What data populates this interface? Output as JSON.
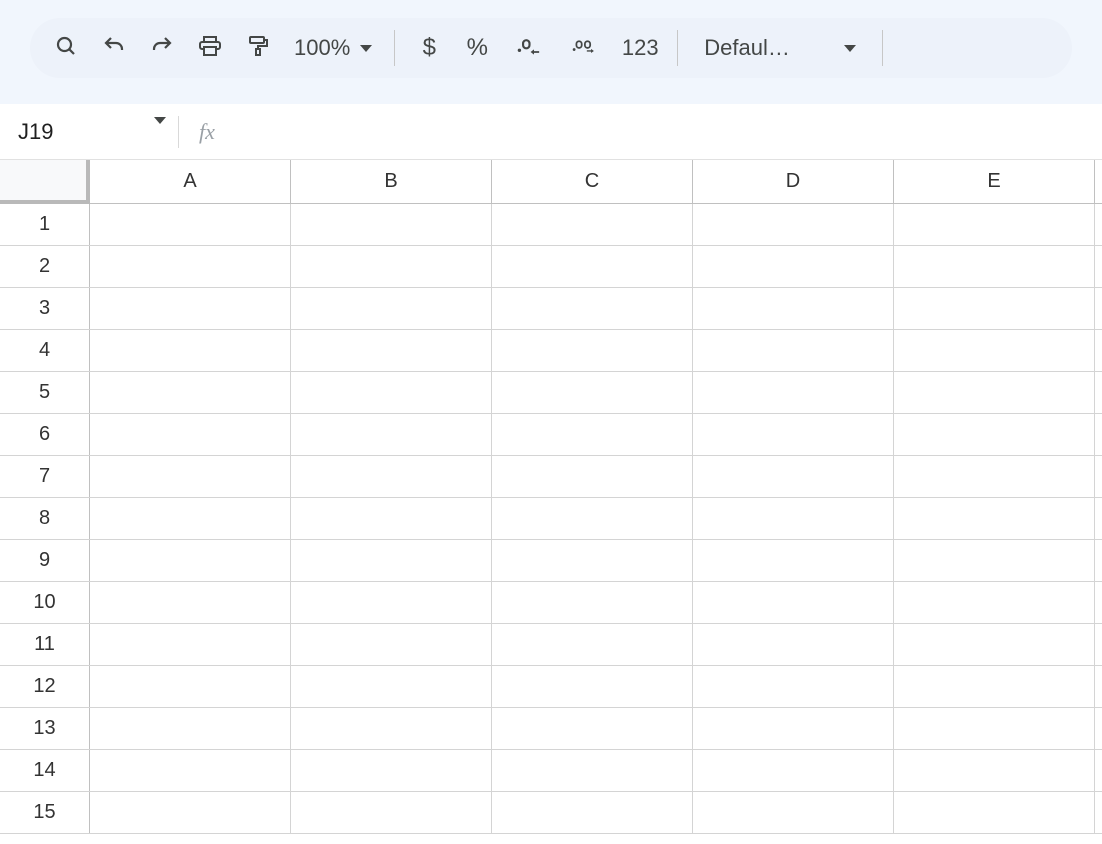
{
  "toolbar": {
    "zoom": "100%",
    "currency_symbol": "$",
    "percent_symbol": "%",
    "number_format_label": "123",
    "font_label": "Defaul…"
  },
  "namebox": {
    "value": "J19"
  },
  "formula": {
    "fx_label": "fx",
    "value": ""
  },
  "grid": {
    "columns": [
      "A",
      "B",
      "C",
      "D",
      "E"
    ],
    "rows": [
      "1",
      "2",
      "3",
      "4",
      "5",
      "6",
      "7",
      "8",
      "9",
      "10",
      "11",
      "12",
      "13",
      "14",
      "15"
    ]
  }
}
